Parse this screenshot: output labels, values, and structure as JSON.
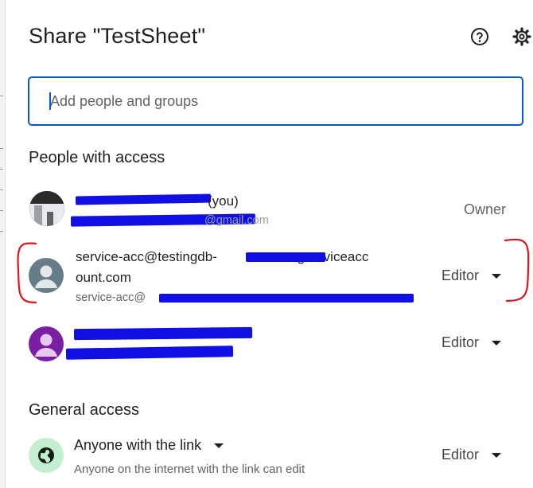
{
  "dialog": {
    "title": "Share \"TestSheet\"",
    "icons": [
      "help-icon",
      "gear-icon"
    ]
  },
  "add_people": {
    "placeholder": "Add people and groups"
  },
  "people_section": {
    "title": "People with access",
    "people": [
      {
        "name_suffix": "(you)",
        "email_suffix": "@gmail.com",
        "role": "Owner",
        "avatar": "photo-avatar"
      },
      {
        "name_prefix": "service-acc@testingdb-",
        "name_suffix": ".gserviceacc",
        "name_line2": "ount.com",
        "email_prefix": "service-acc@",
        "role": "Editor",
        "avatar": "person-icon",
        "avatar_color": "#667c89"
      },
      {
        "role": "Editor",
        "avatar": "person-icon",
        "avatar_color": "#7b1fa2"
      }
    ]
  },
  "general_access": {
    "title": "General access",
    "link_setting": "Anyone with the link",
    "description": "Anyone on the internet with the link can edit",
    "role": "Editor",
    "icon": "globe-icon",
    "icon_bg": "#c4eed0"
  },
  "colors": {
    "accent": "#0b57d0",
    "redaction": "#1010e6",
    "annotation": "#e0141a"
  }
}
